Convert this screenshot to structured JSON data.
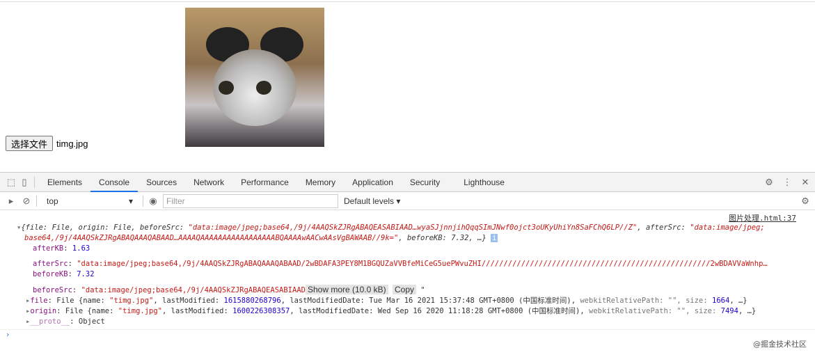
{
  "page": {
    "file_button": "选择文件",
    "file_name": "timg.jpg"
  },
  "devtools": {
    "tabs": [
      "Elements",
      "Console",
      "Sources",
      "Network",
      "Performance",
      "Memory",
      "Application",
      "Security",
      "Lighthouse"
    ],
    "active_tab": "Console",
    "context": "top",
    "filter_placeholder": "Filter",
    "levels": "Default levels ▾",
    "accent": "#1a73e8"
  },
  "console": {
    "source": "图片处理.html:37",
    "summary1": "{file: File, origin: File, beforeSrc: ",
    "summary1_str": "\"data:image/jpeg;base64,/9j/4AAQSkZJRgABAQEASABIAAD…wyaSJjnnjihQqqSImJNwf0ojct3oUKyUhiYn8SaFChQ6LP//Z\"",
    "summary1_mid": ", afterSrc: ",
    "summary1_str2": "\"data:image/jpeg;",
    "summary2_str": "base64,/9j/4AAQSkZJRgABAQAAAQABAAD…AAAAQAAAAAAAAAAAAAAAAABQAAAAwAACwAAsVgBAWAAB//9k=\"",
    "summary2_rest": ", beforeKB: 7.32, …}",
    "afterKB_key": "afterKB",
    "afterKB": "1.63",
    "afterSrc_key": "afterSrc",
    "afterSrc": "\"data:image/jpeg;base64,/9j/4AAQSkZJRgABAQAAAQABAAD/2wBDAFA3PEY8M1BGQUZaVVBfeMiCeG5uePWvuZHI////////////////////////////////////////////////////2wBDAVVaWnhp…",
    "beforeKB_key": "beforeKB",
    "beforeKB": "7.32",
    "beforeSrc_key": "beforeSrc",
    "beforeSrc": "\"data:image/jpeg;base64,/9j/4AAQSkZJRgABAQEASABIAAD",
    "show_more": "Show more (10.0 kB)",
    "copy": "Copy",
    "file_key": "file",
    "file_a": " File {name: ",
    "file_name": "\"timg.jpg\"",
    "file_b": ", lastModified: ",
    "file_lm": "1615880268796",
    "file_c": ", lastModifiedDate: Tue Mar 16 2021 15:37:48 GMT+0800 (中国标准时间), ",
    "file_d": "webkitRelativePath: \"\", size: ",
    "file_size": "1664",
    "file_e": ", …}",
    "origin_key": "origin",
    "origin_a": " File {name: ",
    "origin_name": "\"timg.jpg\"",
    "origin_b": ", lastModified: ",
    "origin_lm": "1600226308357",
    "origin_c": ", lastModifiedDate: Wed Sep 16 2020 11:18:28 GMT+0800 (中国标准时间), ",
    "origin_d": "webkitRelativePath: \"\", size: ",
    "origin_size": "7494",
    "origin_e": ", …}",
    "proto_key": "__proto__",
    "proto_val": ": Object"
  },
  "watermark": "@掘金技术社区"
}
